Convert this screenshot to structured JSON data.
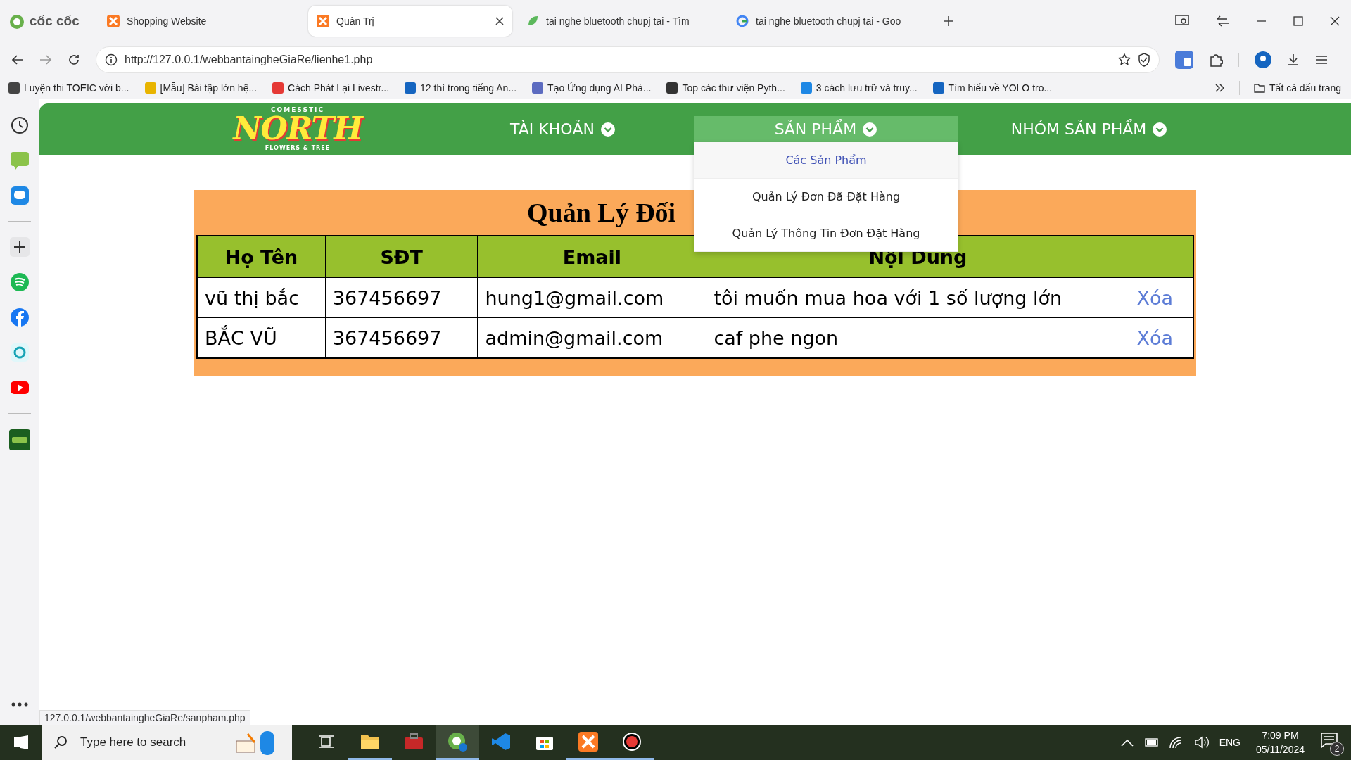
{
  "browser": {
    "brand": "cốc cốc",
    "tabs": [
      {
        "title": "Shopping Website",
        "selected": false
      },
      {
        "title": "Quản Trị",
        "selected": true
      },
      {
        "title": "tai nghe bluetooth chupj tai - Tìm",
        "selected": false
      },
      {
        "title": "tai nghe bluetooth chupj tai - Goo",
        "selected": false
      }
    ],
    "address": "http://127.0.0.1/webbantaingheGiaRe/lienhe1.php",
    "bookmarks": [
      {
        "label": "Luyện thi TOEIC với b..."
      },
      {
        "label": "[Mẫu] Bài tập lớn hệ..."
      },
      {
        "label": "Cách Phát Lại Livestr..."
      },
      {
        "label": "12 thì trong tiếng An..."
      },
      {
        "label": "Tạo Ứng dụng AI Phá..."
      },
      {
        "label": "Top các thư viện Pyth..."
      },
      {
        "label": "3 cách lưu trữ và truy..."
      },
      {
        "label": "Tìm hiểu về YOLO tro..."
      }
    ],
    "bookmarks_folder": "Tất cả dấu trang"
  },
  "site": {
    "logo": {
      "top": "COMESSTIC",
      "main": "NORTH",
      "bottom": "FLOWERS & TREE"
    },
    "nav": [
      {
        "label": "TÀI KHOẢN",
        "expanded": false
      },
      {
        "label": "SẢN PHẨM",
        "expanded": true,
        "menu": [
          {
            "label": "Các Sản Phẩm",
            "selected": true
          },
          {
            "label": "Quản Lý Đơn Đã Đặt Hàng",
            "selected": false
          },
          {
            "label": "Quản Lý Thông Tin Đơn Đặt Hàng",
            "selected": false
          }
        ]
      },
      {
        "label": "NHÓM SẢN PHẨM",
        "expanded": false
      }
    ]
  },
  "panel": {
    "title": "Quản Lý Đối",
    "columns": [
      "Họ Tên",
      "SĐT",
      "Email",
      "Nội Dung"
    ],
    "rows": [
      {
        "cells": [
          "vũ thị bắc",
          "367456697",
          "hung1@gmail.com",
          "tôi muốn mua hoa với 1 số lượng lớn"
        ],
        "action": "Xóa"
      },
      {
        "cells": [
          "BẮC VŨ",
          "367456697",
          "admin@gmail.com",
          "caf phe ngon"
        ],
        "action": "Xóa"
      }
    ]
  },
  "status_url": "127.0.0.1/webbantaingheGiaRe/sanpham.php",
  "taskbar": {
    "search_placeholder": "Type here to search",
    "apps": [
      {
        "kind": "task-view",
        "running": false,
        "selected": false
      },
      {
        "kind": "folder",
        "running": true,
        "selected": false
      },
      {
        "kind": "toolbox",
        "running": false,
        "selected": false
      },
      {
        "kind": "browser",
        "running": true,
        "selected": true
      },
      {
        "kind": "editor",
        "running": false,
        "selected": false
      },
      {
        "kind": "store",
        "running": false,
        "selected": false
      },
      {
        "kind": "server",
        "running": true,
        "selected": false
      },
      {
        "kind": "recorder",
        "running": true,
        "selected": false
      }
    ],
    "tray": {
      "language": "ENG",
      "time": "7:09 PM",
      "date": "05/11/2024",
      "notifications": "2"
    }
  }
}
